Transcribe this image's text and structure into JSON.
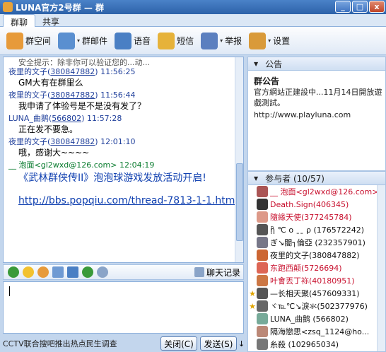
{
  "window": {
    "title": "LUNA官方2号群 — 群",
    "min": "_",
    "max": "□",
    "close": "x"
  },
  "tabs": [
    "群聊",
    "共享"
  ],
  "toolbar": [
    {
      "label": "群空间",
      "icon": "group-space-icon",
      "color": "#e79a3a"
    },
    {
      "label": "群邮件",
      "icon": "mail-icon",
      "color": "#5a8fd0"
    },
    {
      "label": "语音",
      "icon": "voice-icon",
      "color": "#4a7fc4"
    },
    {
      "label": "短信",
      "icon": "sms-icon",
      "color": "#e6b23a"
    },
    {
      "label": "举报",
      "icon": "report-icon",
      "color": "#5b7fbf"
    },
    {
      "label": "设置",
      "icon": "settings-icon",
      "color": "#d99a3a"
    }
  ],
  "chat": {
    "cut_line": "安全提示：除非你可以验证您的...动...",
    "messages": [
      {
        "name": "夜里的文子",
        "qq": "380847882",
        "time": "11:56:25",
        "text": "GM大有在群里么"
      },
      {
        "name": "夜里的文子",
        "qq": "380847882",
        "time": "11:56:44",
        "text": "我申请了体验号是不是没有发了？"
      },
      {
        "name": "LUNA_曲鹅",
        "qq": "566802",
        "time": "11:57:28",
        "text": "正在发不要急。"
      },
      {
        "name": "夜里的文子",
        "qq": "380847882",
        "time": "12:01:10",
        "text": "哦，感谢大~~~~"
      }
    ],
    "last": {
      "name": "__ 泡面<gl2wxd@126.com>",
      "time": "12:04:19",
      "text": "《武林群侠传II》泡泡球游戏发放活动开启!",
      "link": "http://bbs.popqiu.com/thread-7813-1-1.html"
    }
  },
  "format_bar": {
    "history": "聊天记录"
  },
  "bottom": {
    "news": "CCTV联合搜吧推出热点民生调查",
    "close": "关闭(C)",
    "send": "发送(S)"
  },
  "notice": {
    "header": "公告",
    "title": "群公告",
    "body": "官方網站正建設中...11月14日開放遊戲測試。",
    "url": "http://www.playluna.com"
  },
  "members": {
    "header": "参与者 (10/57)",
    "list": [
      {
        "name": "__ 泡面<gl2wxd@126.com>",
        "color": "#c8102e",
        "star": false,
        "av": "#a55"
      },
      {
        "name": "Death.Sign(406345)",
        "color": "#c8102e",
        "star": false,
        "av": "#333"
      },
      {
        "name": "隨緣天使(377245784)",
        "color": "#c8102e",
        "star": false,
        "av": "#d98"
      },
      {
        "name": "ᾒ ℃ ο ˍˍ ρ (176572242)",
        "color": "#111",
        "star": false,
        "av": "#555"
      },
      {
        "name": "ぎ↘闇┐倫亞 (232357901)",
        "color": "#111",
        "star": false,
        "av": "#778"
      },
      {
        "name": "夜里的文子(380847882)",
        "color": "#111",
        "star": false,
        "av": "#c63"
      },
      {
        "name": "东跑西颠(5726694)",
        "color": "#c8102e",
        "star": false,
        "av": "#d65"
      },
      {
        "name": "叶會丟丁袮(40180951)",
        "color": "#c8102e",
        "star": false,
        "av": "#c74"
      },
      {
        "name": "—长相天聚(457609331)",
        "color": "#111",
        "star": true,
        "av": "#555"
      },
      {
        "name": "ヾ℡℃↘淚氺(502377976)",
        "color": "#111",
        "star": true,
        "av": "#666"
      },
      {
        "name": "LUNA_曲鹅 (566802)",
        "color": "#111",
        "star": false,
        "av": "#7a9"
      },
      {
        "name": "隔海戀思<zsq_1124@ho...",
        "color": "#111",
        "star": false,
        "av": "#b87"
      },
      {
        "name": "糸殺 (102965034)",
        "color": "#111",
        "star": false,
        "av": "#777"
      }
    ]
  }
}
